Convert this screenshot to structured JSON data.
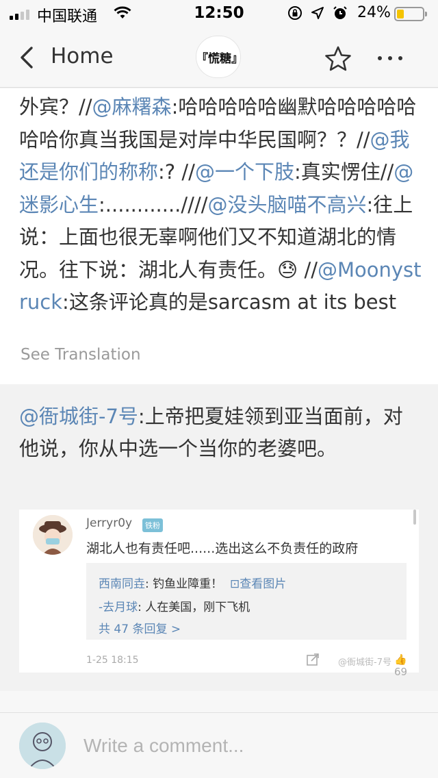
{
  "status_bar": {
    "carrier": "中国联通",
    "time": "12:50",
    "battery_percent": "24%",
    "battery_level": 0.24,
    "signal_bars_on": 2
  },
  "nav": {
    "back_label": "Home",
    "logo_text": "『慌糖』",
    "icons": [
      "chevron-left-icon",
      "star-icon",
      "more-icon"
    ]
  },
  "post": {
    "segments": [
      {
        "text": "外宾？//",
        "mention": false
      },
      {
        "text": "@麻糬森",
        "mention": true
      },
      {
        "text": ":哈哈哈哈哈幽默哈哈哈哈哈哈哈你真当我国是对岸中华民国啊？？//",
        "mention": false
      },
      {
        "text": "@我还是你们的称称",
        "mention": true
      },
      {
        "text": ":?  //",
        "mention": false
      },
      {
        "text": "@一个下肢",
        "mention": true
      },
      {
        "text": ":真实愣住//",
        "mention": false
      },
      {
        "text": "@迷影心生",
        "mention": true
      },
      {
        "text": ":............////",
        "mention": false
      },
      {
        "text": "@没头脑喵不高兴",
        "mention": true
      },
      {
        "text": ":往上说：上面也很无辜啊他们又不知道湖北的情况。往下说：湖北人有责任。😓 //",
        "mention": false
      },
      {
        "text": "@Moonystruck",
        "mention": true
      },
      {
        "text": ":这条评论真的是sarcasm at its best",
        "mention": false
      }
    ],
    "see_translation": "See Translation"
  },
  "comment": {
    "mention": "@衙城街-7号",
    "text": ":上帝把夏娃领到亚当面前，对他说，你从中选一个当你的老婆吧。",
    "embed": {
      "username": "Jerryr0y",
      "badge": "铁粉",
      "text": "湖北人也有责任吧......选出这么不负责任的政府",
      "replies": [
        {
          "who": "西南同垚",
          "text": ": 钓鱼业障重！",
          "link": "查看图片"
        },
        {
          "who": "-去月球",
          "text": ": 人在美国，刚下飞机",
          "link": ""
        }
      ],
      "more_replies": "共 47 条回复 >",
      "date": "1-25 18:15",
      "watermark": "@衙城街-7号",
      "likes": "69"
    }
  },
  "input": {
    "placeholder": "Write a comment..."
  }
}
